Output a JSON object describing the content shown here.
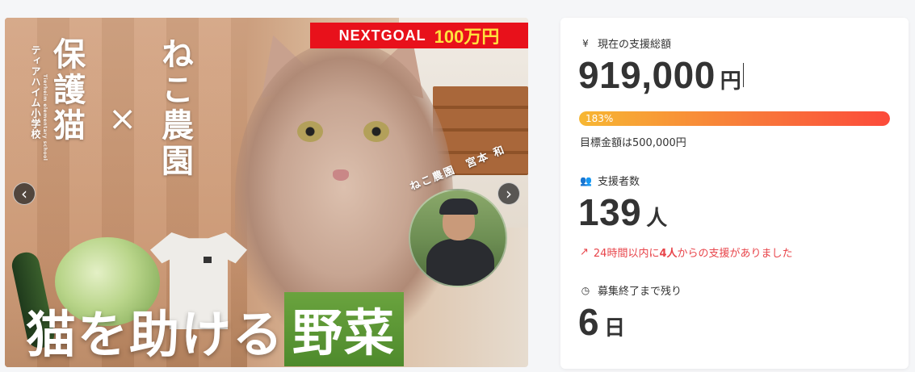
{
  "hero": {
    "goal_label": "NEXTGOAL",
    "goal_amount": "100万円",
    "school_name": "ティアハイム小学校",
    "school_roman": "Tierheim elementary school",
    "title_left": "保護猫",
    "title_cross": "×",
    "title_right": "ねこ農園",
    "farmer_caption": "ねこ農園　宮本 和",
    "headline_main": "猫を助ける",
    "headline_accent": "野菜",
    "prev_icon": "chevron-left-icon",
    "next_icon": "chevron-right-icon",
    "prev_label": "‹",
    "next_label": "›"
  },
  "stats": {
    "total": {
      "icon": "yen-icon",
      "icon_glyph": "¥",
      "label": "現在の支援総額",
      "value": "919,000",
      "unit": "円"
    },
    "progress": {
      "percent_label": "183%",
      "fill_fraction": 1.0,
      "goal_text": "目標金額は500,000円"
    },
    "supporters": {
      "icon": "users-icon",
      "icon_glyph": "👥",
      "label": "支援者数",
      "value": "139",
      "unit": "人"
    },
    "trend": {
      "icon": "trending-up-icon",
      "icon_glyph": "↗",
      "prefix": "24時間以内に",
      "count": "4人",
      "suffix": "からの支援がありました"
    },
    "remaining": {
      "icon": "clock-icon",
      "icon_glyph": "◷",
      "label": "募集終了まで残り",
      "value": "6",
      "unit": "日"
    }
  },
  "colors": {
    "goal_banner": "#e8111b",
    "goal_amount": "#ffe23d",
    "headline_accent": "#4e8a2c",
    "trend": "#e8444a",
    "progress_start": "#f7b733",
    "progress_end": "#fc4a3a"
  }
}
